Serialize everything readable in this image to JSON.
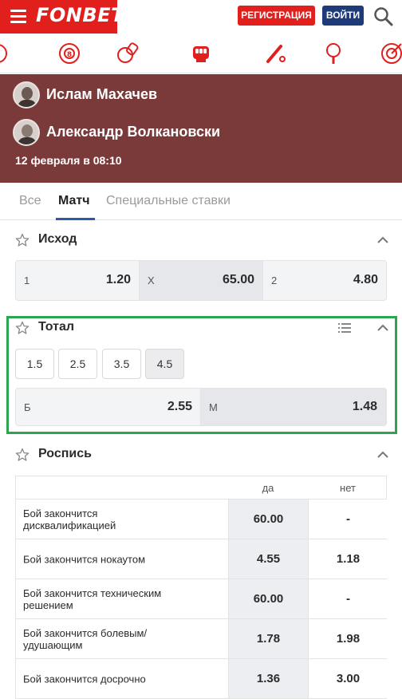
{
  "header": {
    "logo": "FONBET",
    "register_label": "РЕГИСТРАЦИЯ",
    "login_label": "ВОЙТИ"
  },
  "sports_icons": [
    "snooker-icon",
    "volleyball-icon",
    "mma-glove-icon",
    "cricket-icon",
    "table-tennis-icon",
    "darts-icon"
  ],
  "match": {
    "fighter1": "Ислам Махачев",
    "fighter2": "Александр Волкановски",
    "date": "12 февраля в 08:10",
    "header_color": "#7a3a3a"
  },
  "tabs": [
    {
      "label": "Все",
      "active": false
    },
    {
      "label": "Матч",
      "active": true
    },
    {
      "label": "Специальные ставки",
      "active": false
    }
  ],
  "outcome": {
    "title": "Исход",
    "cells": [
      {
        "label": "1",
        "value": "1.20"
      },
      {
        "label": "X",
        "value": "65.00"
      },
      {
        "label": "2",
        "value": "4.80"
      }
    ]
  },
  "total": {
    "title": "Тотал",
    "options": [
      "1.5",
      "2.5",
      "3.5",
      "4.5"
    ],
    "selected": "4.5",
    "cells": [
      {
        "label": "Б",
        "value": "2.55"
      },
      {
        "label": "М",
        "value": "1.48"
      }
    ]
  },
  "props": {
    "title": "Роспись",
    "col_yes": "да",
    "col_no": "нет",
    "rows": [
      {
        "name": "Бой закончится дисквалификацией",
        "yes": "60.00",
        "no": "-"
      },
      {
        "name": "Бой закончится нокаутом",
        "yes": "4.55",
        "no": "1.18"
      },
      {
        "name": "Бой закончится техническим решением",
        "yes": "60.00",
        "no": "-"
      },
      {
        "name": "Бой закончится болевым/ удушающим",
        "yes": "1.78",
        "no": "1.98"
      },
      {
        "name": "Бой закончится досрочно",
        "yes": "1.36",
        "no": "3.00"
      }
    ]
  }
}
